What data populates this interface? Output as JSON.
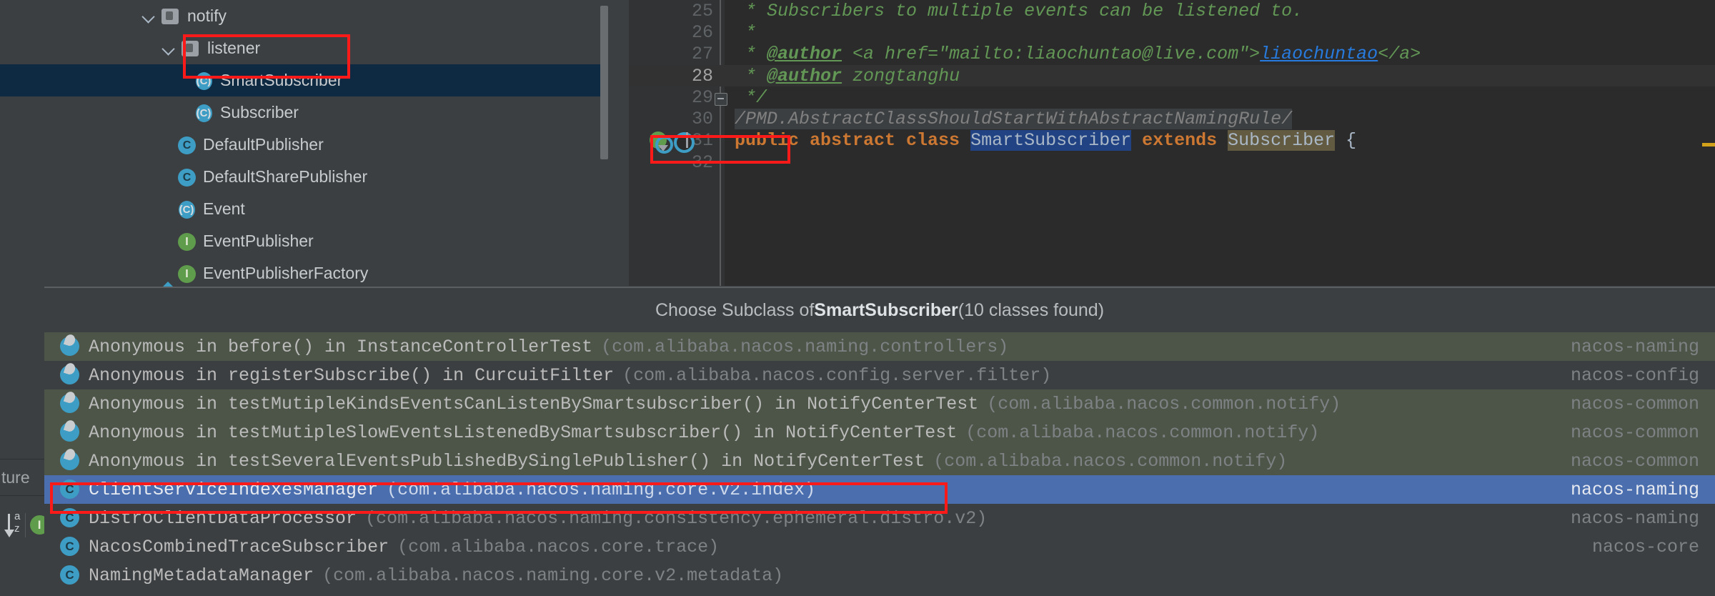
{
  "project_tree": {
    "rows": [
      {
        "label": "notify",
        "icon": "package-icon",
        "indent": 196,
        "chevron": true,
        "type": "pkg",
        "selected": false
      },
      {
        "label": "listener",
        "icon": "package-icon",
        "indent": 224,
        "chevron": true,
        "type": "pkg",
        "selected": false
      },
      {
        "label": "SmartSubscriber",
        "icon": "abstract-class-icon",
        "indent": 268,
        "chevron": false,
        "type": "acls",
        "selected": true
      },
      {
        "label": "Subscriber",
        "icon": "abstract-class-icon",
        "indent": 268,
        "chevron": false,
        "type": "acls",
        "selected": false
      },
      {
        "label": "DefaultPublisher",
        "icon": "class-icon",
        "indent": 244,
        "chevron": false,
        "type": "cls",
        "selected": false
      },
      {
        "label": "DefaultSharePublisher",
        "icon": "class-icon",
        "indent": 244,
        "chevron": false,
        "type": "cls",
        "selected": false
      },
      {
        "label": "Event",
        "icon": "abstract-class-icon",
        "indent": 244,
        "chevron": false,
        "type": "acls",
        "selected": false
      },
      {
        "label": "EventPublisher",
        "icon": "interface-icon",
        "indent": 244,
        "chevron": false,
        "type": "iface",
        "selected": false
      },
      {
        "label": "EventPublisherFactory",
        "icon": "interface-icon",
        "indent": 244,
        "chevron": false,
        "type": "iface",
        "selected": false
      }
    ]
  },
  "editor": {
    "lines": [
      {
        "num": "25",
        "current": false,
        "type": "comment",
        "text": " * Subscribers to multiple events can be listened to."
      },
      {
        "num": "26",
        "current": false,
        "type": "comment",
        "text": " *"
      },
      {
        "num": "27",
        "current": false,
        "type": "author_link",
        "prefix": " * ",
        "tag": "@author",
        "mid": " <a href=\"mailto:liaochuntao@live.com\">",
        "link": "liaochuntao",
        "suffix": "</a>"
      },
      {
        "num": "28",
        "current": true,
        "type": "author",
        "prefix": " * ",
        "tag": "@author",
        "value": " zongtanghu"
      },
      {
        "num": "29",
        "current": false,
        "type": "comment",
        "text": " */",
        "fold": true
      },
      {
        "num": "30",
        "current": false,
        "type": "pmd",
        "text": "/PMD.AbstractClassShouldStartWithAbstractNamingRule/"
      },
      {
        "num": "31",
        "current": false,
        "type": "declaration",
        "kw1": "public abstract class ",
        "cls_name": "SmartSubscriber",
        "kw2": " extends ",
        "super_name": "Subscriber",
        "brace": " {",
        "gutter_icons": [
          "implemented-marker-icon",
          "overridden-marker-icon"
        ]
      },
      {
        "num": "32",
        "current": false,
        "type": "blank",
        "text": ""
      }
    ]
  },
  "popup": {
    "title_prefix": "Choose Subclass of ",
    "title_class": "SmartSubscriber",
    "title_suffix": " (10 classes found)",
    "items": [
      {
        "icon": "anonymous-class-icon",
        "main": "Anonymous in before() in InstanceControllerTest",
        "pkg": "(com.alibaba.nacos.naming.controllers)",
        "module": "nacos-naming",
        "style": "tint",
        "selected": false
      },
      {
        "icon": "anonymous-class-icon",
        "main": "Anonymous in registerSubscribe() in CurcuitFilter",
        "pkg": "(com.alibaba.nacos.config.server.filter)",
        "module": "nacos-config",
        "style": "dark",
        "selected": false
      },
      {
        "icon": "anonymous-class-icon",
        "main": "Anonymous in testMutipleKindsEventsCanListenBySmartsubscriber() in NotifyCenterTest",
        "pkg": "(com.alibaba.nacos.common.notify)",
        "module": "nacos-common",
        "style": "tint",
        "selected": false
      },
      {
        "icon": "anonymous-class-icon",
        "main": "Anonymous in testMutipleSlowEventsListenedBySmartsubscriber() in NotifyCenterTest",
        "pkg": "(com.alibaba.nacos.common.notify)",
        "module": "nacos-common",
        "style": "tint",
        "selected": false
      },
      {
        "icon": "anonymous-class-icon",
        "main": "Anonymous in testSeveralEventsPublishedBySinglePublisher() in NotifyCenterTest",
        "pkg": "(com.alibaba.nacos.common.notify)",
        "module": "nacos-common",
        "style": "tint",
        "selected": false
      },
      {
        "icon": "class-icon",
        "main": "ClientServiceIndexesManager",
        "pkg": "(com.alibaba.nacos.naming.core.v2.index)",
        "module": "nacos-naming",
        "style": "sel",
        "selected": true
      },
      {
        "icon": "class-icon",
        "main": "DistroClientDataProcessor",
        "pkg": "(com.alibaba.nacos.naming.consistency.ephemeral.distro.v2)",
        "module": "nacos-naming",
        "style": "dark",
        "selected": false
      },
      {
        "icon": "class-icon",
        "main": "NacosCombinedTraceSubscriber",
        "pkg": "(com.alibaba.nacos.core.trace)",
        "module": "nacos-core",
        "style": "dark",
        "selected": false
      },
      {
        "icon": "class-icon",
        "main": "NamingMetadataManager",
        "pkg": "(com.alibaba.nacos.naming.core.v2.metadata)",
        "module": "",
        "style": "dark",
        "selected": false
      }
    ]
  },
  "left_panel": {
    "structure_tab_label": "ture",
    "sort_alpha_icon": "sort-alphabetically-icon",
    "interface_filter_icon": "interface-icon"
  },
  "colors": {
    "accent_blue": "#4b6eaf",
    "selection_tree": "#0d2a42",
    "annotation_red": "#ff1a1a",
    "comment_green": "#629755",
    "keyword_orange": "#cc7832",
    "identifier": "#a9b7c6",
    "highlight_blue": "#214283",
    "highlight_olive": "#625b41"
  }
}
